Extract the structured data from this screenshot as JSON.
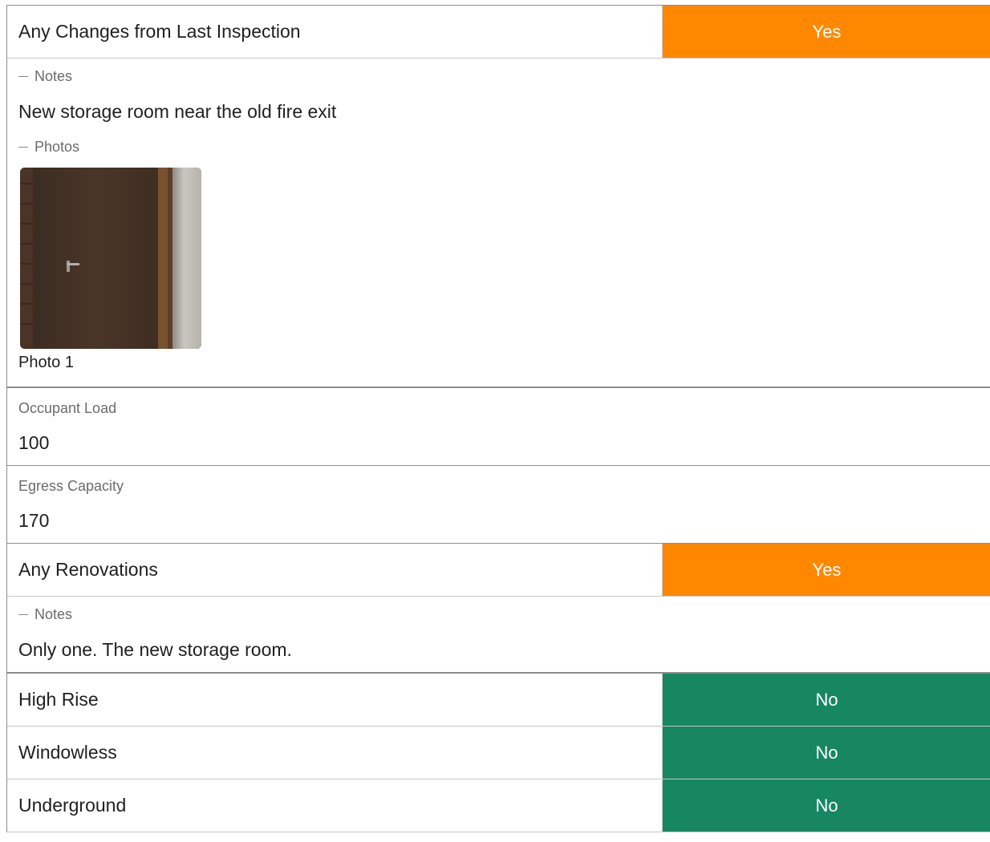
{
  "changes": {
    "label": "Any Changes from Last Inspection",
    "answer": "Yes",
    "notes_label": "Notes",
    "notes_text": "New storage room near the old fire exit",
    "photos_label": "Photos",
    "photo_caption": "Photo 1"
  },
  "occupant_load": {
    "label": "Occupant Load",
    "value": "100"
  },
  "egress_capacity": {
    "label": "Egress Capacity",
    "value": "170"
  },
  "renovations": {
    "label": "Any Renovations",
    "answer": "Yes",
    "notes_label": "Notes",
    "notes_text": "Only one. The new storage room."
  },
  "high_rise": {
    "label": "High Rise",
    "answer": "No"
  },
  "windowless": {
    "label": "Windowless",
    "answer": "No"
  },
  "underground": {
    "label": "Underground",
    "answer": "No"
  },
  "colors": {
    "yes": "#ff8800",
    "no": "#168760"
  }
}
